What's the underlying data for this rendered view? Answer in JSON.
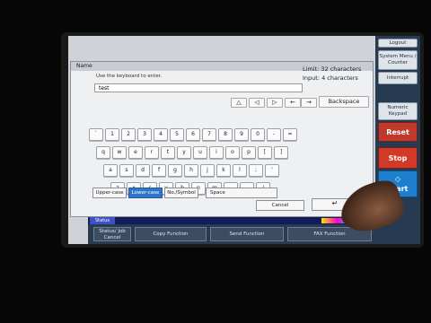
{
  "dialog": {
    "title": "Name",
    "prompt": "Use the keyboard to enter.",
    "limit": "Limit: 32 characters",
    "input_count": "Input: 4 characters",
    "text_value": "test",
    "backspace": "Backspace",
    "left_arrow": "←",
    "right_arrow": "→",
    "up_arrow": "△",
    "back_arrow": "◁",
    "fwd_arrow": "▷",
    "num_keys": [
      "`",
      "1",
      "2",
      "3",
      "4",
      "5",
      "6",
      "7",
      "8",
      "9",
      "0",
      "-",
      "="
    ],
    "row_q": [
      "q",
      "w",
      "e",
      "r",
      "t",
      "y",
      "u",
      "i",
      "o",
      "p",
      "[",
      "]"
    ],
    "row_a": [
      "a",
      "s",
      "d",
      "f",
      "g",
      "h",
      "j",
      "k",
      "l",
      ";",
      "'"
    ],
    "row_z": [
      "z",
      "x",
      "c",
      "v",
      "b",
      "n",
      "m",
      ",",
      ".",
      "/"
    ],
    "upper": "Upper-case",
    "lower": "Lower-case",
    "numsym": "No./Symbol",
    "space": "Space",
    "cancel": "Cancel",
    "ok_symbol": "↵"
  },
  "right": {
    "logout": "Logout",
    "system_menu": "System Menu / Counter",
    "interrupt": "Interrupt",
    "numeric": "Numeric Keypad",
    "reset": "Reset",
    "stop": "Stop",
    "start": "Start",
    "start_icon": "◇"
  },
  "bottom": {
    "status": "Status",
    "status_job": "Status/ Job Cancel",
    "copy": "Copy Function",
    "send": "Send Function",
    "fax": "FAX Function"
  }
}
